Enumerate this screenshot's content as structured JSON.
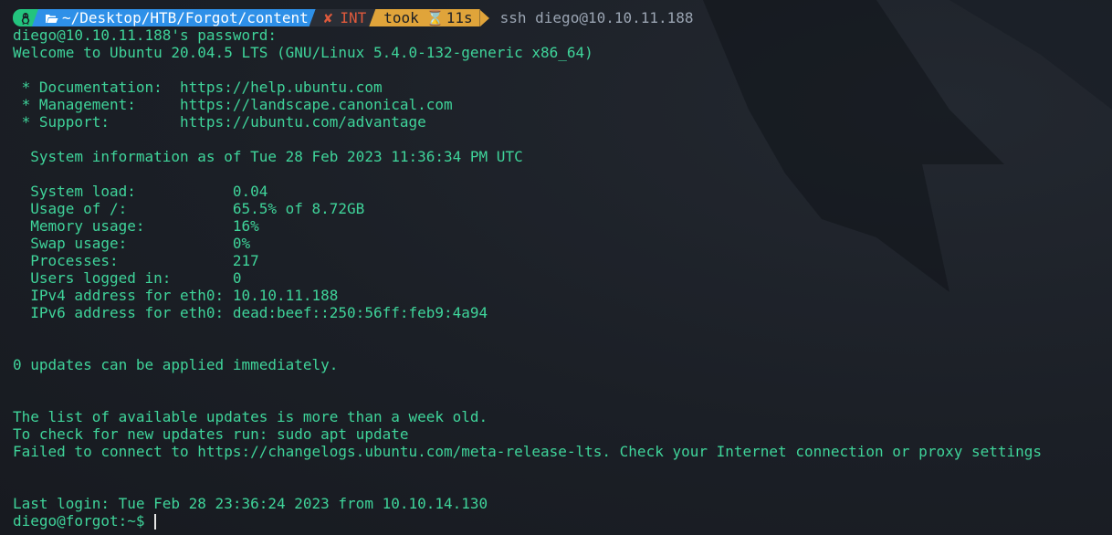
{
  "prompt": {
    "os_icon": "linux-tux-icon",
    "folder_icon": "folder-open-icon",
    "path": "~/Desktop/HTB/Forgot/content",
    "status_icon": "cross-icon",
    "status_symbol": "✘",
    "status_text": "INT",
    "took_label": "took",
    "hourglass_icon": "hourglass-icon",
    "hourglass_symbol": "⌛",
    "took_value": "11s",
    "command": "ssh diego@10.10.11.188"
  },
  "output": {
    "password_prompt": "diego@10.10.11.188's password:",
    "welcome": "Welcome to Ubuntu 20.04.5 LTS (GNU/Linux 5.4.0-132-generic x86_64)",
    "links": [
      " * Documentation:  https://help.ubuntu.com",
      " * Management:     https://landscape.canonical.com",
      " * Support:        https://ubuntu.com/advantage"
    ],
    "sysinfo_header": "  System information as of Tue 28 Feb 2023 11:36:34 PM UTC",
    "sysinfo": [
      "  System load:           0.04",
      "  Usage of /:            65.5% of 8.72GB",
      "  Memory usage:          16%",
      "  Swap usage:            0%",
      "  Processes:             217",
      "  Users logged in:       0",
      "  IPv4 address for eth0: 10.10.11.188",
      "  IPv6 address for eth0: dead:beef::250:56ff:feb9:4a94"
    ],
    "updates": "0 updates can be applied immediately.",
    "list_old": "The list of available updates is more than a week old.",
    "check_updates": "To check for new updates run: sudo apt update",
    "failed_connect": "Failed to connect to https://changelogs.ubuntu.com/meta-release-lts. Check your Internet connection or proxy settings",
    "last_login": "Last login: Tue Feb 28 23:36:24 2023 from 10.10.14.130",
    "shell_prompt": "diego@forgot:~$ "
  },
  "colors": {
    "background": "#1b1f26",
    "text": "#3fd49a",
    "os_segment": "#23c47e",
    "path_segment": "#2e90e8",
    "status_segment": "#2a2e36",
    "status_text": "#e05a3c",
    "took_segment": "#e0a43a",
    "command_text": "#9aa4b2"
  }
}
